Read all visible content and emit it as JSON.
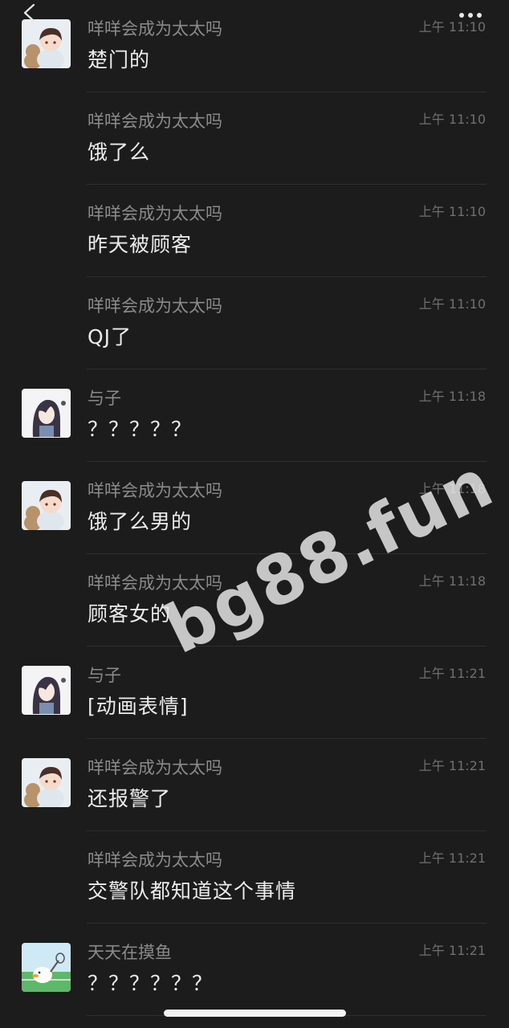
{
  "messages": [
    {
      "sender": "咩咩会成为太太吗",
      "time": "上午 11:10",
      "text": "楚门的",
      "avatar": "boy-avatar"
    },
    {
      "sender": "咩咩会成为太太吗",
      "time": "上午 11:10",
      "text": "饿了么",
      "avatar": ""
    },
    {
      "sender": "咩咩会成为太太吗",
      "time": "上午 11:10",
      "text": "昨天被顾客",
      "avatar": ""
    },
    {
      "sender": "咩咩会成为太太吗",
      "time": "上午 11:10",
      "text": "QJ了",
      "avatar": ""
    },
    {
      "sender": "与子",
      "time": "上午 11:18",
      "text": "？？？？？",
      "avatar": "longhair-avatar"
    },
    {
      "sender": "咩咩会成为太太吗",
      "time": "上午 11:18",
      "text": "饿了么男的",
      "avatar": "boy-avatar"
    },
    {
      "sender": "咩咩会成为太太吗",
      "time": "上午 11:18",
      "text": "顾客女的",
      "avatar": ""
    },
    {
      "sender": "与子",
      "time": "上午 11:21",
      "text": "[动画表情]",
      "avatar": "longhair-avatar"
    },
    {
      "sender": "咩咩会成为太太吗",
      "time": "上午 11:21",
      "text": "还报警了",
      "avatar": "boy-avatar"
    },
    {
      "sender": "咩咩会成为太太吗",
      "time": "上午 11:21",
      "text": "交警队都知道这个事情",
      "avatar": ""
    },
    {
      "sender": "天天在摸鱼",
      "time": "上午 11:21",
      "text": "？？？？？？",
      "avatar": "duck-avatar"
    }
  ],
  "watermark": "bg88.fun",
  "icons": {
    "back": "back-chevron-icon",
    "more": "more-dots-icon"
  },
  "colors": {
    "background": "#1c1c1c",
    "sender": "#8a8a8a",
    "time": "#6f6f6f",
    "text": "#ececec"
  }
}
